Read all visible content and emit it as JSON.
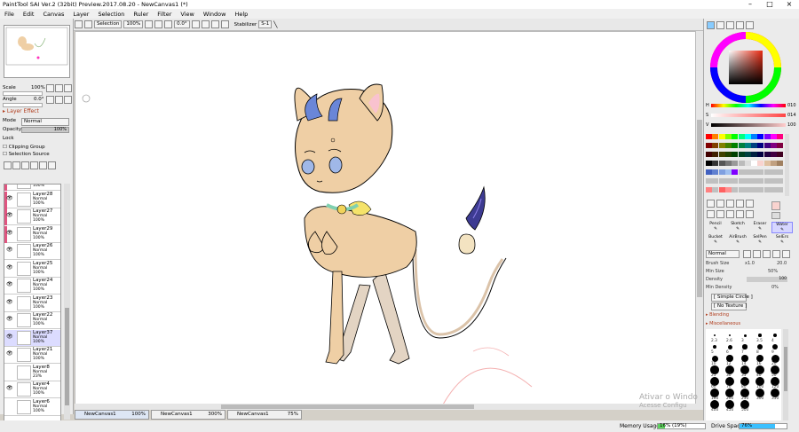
{
  "window": {
    "title": "PaintTool SAI Ver.2 (32bit) Preview.2017.08.20 - NewCanvas1 (*)",
    "min": "–",
    "max": "□",
    "close": "×"
  },
  "menu": [
    "File",
    "Edit",
    "Canvas",
    "Layer",
    "Selection",
    "Ruler",
    "Filter",
    "View",
    "Window",
    "Help"
  ],
  "toolbar": {
    "selection": "Selection",
    "zoom": "100%",
    "angle": "0.0°",
    "stabilizer_label": "Stabilizer",
    "stabilizer_value": "S-1"
  },
  "nav": {
    "scale_label": "Scale",
    "scale_value": "100%",
    "angle_label": "Angle",
    "angle_value": "0.0°"
  },
  "layer_effect": {
    "title": "Layer Effect",
    "mode_label": "Mode",
    "mode_value": "Normal",
    "opacity_label": "Opacity",
    "opacity_value": "100%",
    "lock_label": "Lock",
    "clipping": "Clipping Group",
    "selection_source": "Selection Source"
  },
  "layers": [
    {
      "name": "",
      "mode": "",
      "opacity": "100%",
      "pink": true,
      "sel": false,
      "eye": false
    },
    {
      "name": "Layer28",
      "mode": "Normal",
      "opacity": "100%",
      "pink": true,
      "sel": false,
      "eye": true
    },
    {
      "name": "Layer27",
      "mode": "Normal",
      "opacity": "100%",
      "pink": true,
      "sel": false,
      "eye": true
    },
    {
      "name": "Layer29",
      "mode": "Normal",
      "opacity": "100%",
      "pink": true,
      "sel": false,
      "eye": true
    },
    {
      "name": "Layer26",
      "mode": "Normal",
      "opacity": "100%",
      "pink": false,
      "sel": false,
      "eye": true
    },
    {
      "name": "Layer25",
      "mode": "Normal",
      "opacity": "100%",
      "pink": false,
      "sel": false,
      "eye": true
    },
    {
      "name": "Layer24",
      "mode": "Normal",
      "opacity": "100%",
      "pink": false,
      "sel": false,
      "eye": true
    },
    {
      "name": "Layer23",
      "mode": "Normal",
      "opacity": "100%",
      "pink": false,
      "sel": false,
      "eye": true
    },
    {
      "name": "Layer22",
      "mode": "Normal",
      "opacity": "100%",
      "pink": false,
      "sel": false,
      "eye": true
    },
    {
      "name": "Layer37",
      "mode": "Normal",
      "opacity": "100%",
      "pink": false,
      "sel": true,
      "eye": true
    },
    {
      "name": "Layer21",
      "mode": "Normal",
      "opacity": "100%",
      "pink": false,
      "sel": false,
      "eye": true
    },
    {
      "name": "Layer8",
      "mode": "Normal",
      "opacity": "23%",
      "pink": false,
      "sel": false,
      "eye": false
    },
    {
      "name": "Layer4",
      "mode": "Normal",
      "opacity": "100%",
      "pink": false,
      "sel": false,
      "eye": true
    },
    {
      "name": "Layer6",
      "mode": "Normal",
      "opacity": "100%",
      "pink": false,
      "sel": false,
      "eye": false
    }
  ],
  "canvas_tabs": [
    {
      "name": "NewCanvas1",
      "pct": "100%"
    },
    {
      "name": "NewCanvas1",
      "pct": "300%"
    },
    {
      "name": "NewCanvas1",
      "pct": "75%"
    }
  ],
  "color": {
    "h_label": "H",
    "h_value": "010",
    "s_label": "S",
    "s_value": "014",
    "v_label": "V",
    "v_value": "100"
  },
  "tools": [
    [
      "Pencil",
      "Sketch",
      "Eraser",
      "Water"
    ],
    [
      "Bucket",
      "AirBrush",
      "SelPen",
      "SelErs"
    ]
  ],
  "brush": {
    "mode": "Normal",
    "size_label": "Brush Size",
    "size_mult": "x1.0",
    "size_value": "20.0",
    "min_size_label": "Min Size",
    "min_size_value": "50%",
    "density_label": "Density",
    "density_value": "100",
    "min_density_label": "Min Density",
    "min_density_value": "0%",
    "shape": "[ Simple Circle ]",
    "texture": "[ No Texture ]",
    "blending": "Blending",
    "misc": "Miscellaneous"
  },
  "brush_sizes": [
    "2.3",
    "2.6",
    "3",
    "3.5",
    "4",
    "5",
    "6",
    "7",
    "8",
    "9",
    "10",
    "12",
    "14",
    "16",
    "20",
    "25",
    "30",
    "35",
    "40",
    "50",
    "60",
    "70",
    "80",
    "100",
    "120",
    "160",
    "200",
    "250",
    "300",
    "350",
    "400",
    "450",
    "500"
  ],
  "status": {
    "memory_label": "Memory Usage",
    "memory_value": "16% (19%)",
    "memory_pct": 16,
    "drive_label": "Drive Space",
    "drive_value": "76%",
    "drive_pct": 76
  },
  "watermark": {
    "line1": "Ativar o Windo",
    "line2": "Acesse Configu"
  }
}
